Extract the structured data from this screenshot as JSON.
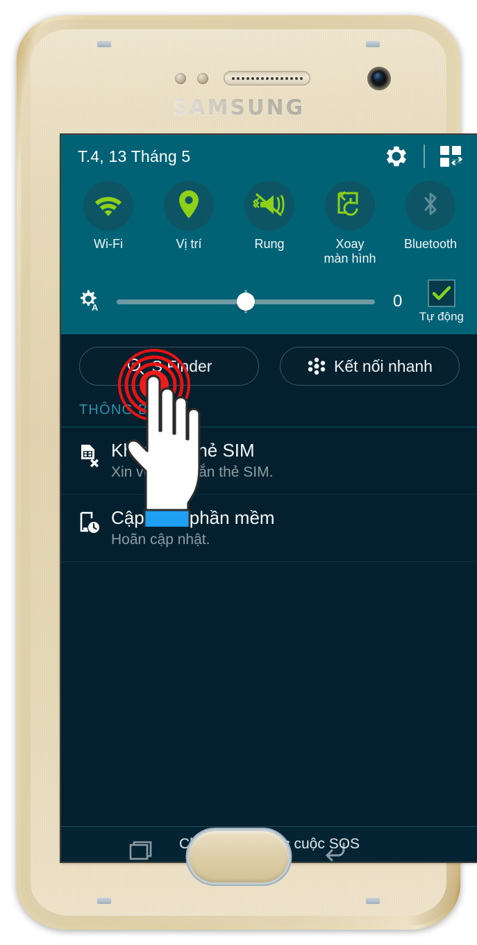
{
  "device": {
    "brand": "SAMSUNG",
    "body_color": "#e1d3ae",
    "home_button": "home-button",
    "recents_key": "recents-key",
    "back_key": "back-key"
  },
  "colors": {
    "quick_settings_bg": "#016275",
    "notification_bg": "#04202e",
    "accent_green": "#8fd118",
    "toggle_circle": "#0d5565",
    "inactive_icon": "#5f8e99",
    "section_header": "#2f91a8",
    "tap_indicator": "#e81212"
  },
  "quick_settings": {
    "date": "T.4, 13 Tháng 5",
    "settings_icon": "gear-icon",
    "edit_icon": "grid-edit-icon",
    "toggles": [
      {
        "label": "Wi-Fi",
        "icon": "wifi-icon",
        "active": true
      },
      {
        "label": "Vị trí",
        "icon": "location-pin-icon",
        "active": true
      },
      {
        "label": "Rung",
        "icon": "vibrate-mute-icon",
        "active": true
      },
      {
        "label": "Xoay\nmàn hình",
        "label_line1": "Xoay",
        "label_line2": "màn hình",
        "icon": "screen-rotation-icon",
        "active": true
      },
      {
        "label": "Bluetooth",
        "icon": "bluetooth-icon",
        "active": false
      }
    ],
    "brightness": {
      "icon": "brightness-auto-icon",
      "value": "0",
      "slider_percent": 50,
      "auto_label": "Tự động",
      "auto_checked": true
    }
  },
  "actions": {
    "s_finder": {
      "label": "S Finder",
      "icon": "search-icon"
    },
    "quick_connect": {
      "label": "Kết nối nhanh",
      "icon": "quick-connect-icon"
    }
  },
  "notifications": {
    "section_title": "THÔNG BÁO",
    "items": [
      {
        "icon": "sim-card-error-icon",
        "title": "Không có thẻ SIM",
        "subtitle": "Xin vui lòng gắn thẻ SIM."
      },
      {
        "icon": "software-update-icon",
        "title": "Cập nhật phần mềm",
        "subtitle": "Hoãn cập nhật."
      }
    ]
  },
  "status_bar": {
    "text": "Chỉ gọi được các cuộc SOS"
  },
  "cursor": {
    "type": "hand-cursor",
    "tap_indicator": "tap-ripple",
    "target": "S Finder"
  }
}
